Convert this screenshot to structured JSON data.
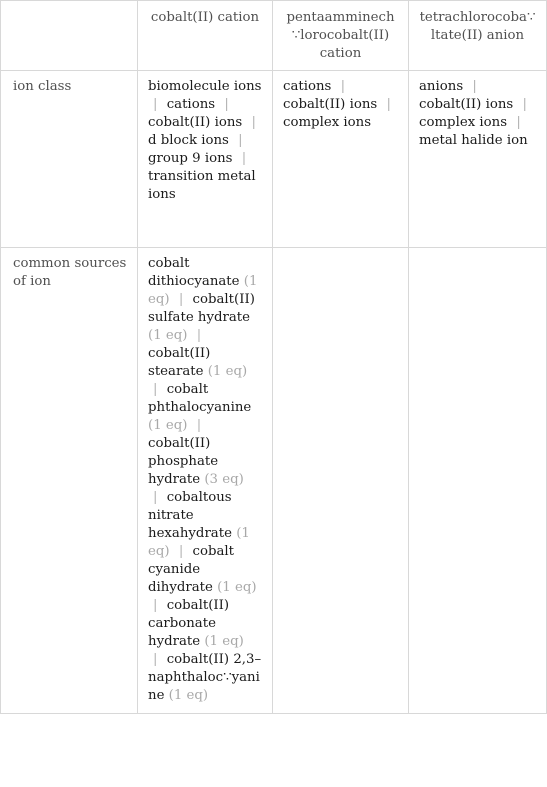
{
  "table": {
    "columns": [
      "",
      "cobalt(II) cation",
      "pentaamminechlorocobalt(II) cation",
      "tetrachlorocobaltate(II) anion"
    ],
    "column_display": [
      "",
      "cobalt(II) cation",
      "pentaamminech∵lorocobalt(II) cation",
      "tetrachlorocoba∵ltate(II) anion"
    ],
    "rows": [
      {
        "label": "ion class",
        "cells": [
          {
            "items": [
              {
                "text": "biomolecule ions"
              },
              {
                "text": "cations"
              },
              {
                "text": "cobalt(II) ions"
              },
              {
                "text": "d block ions"
              },
              {
                "text": "group 9 ions"
              },
              {
                "text": "transition metal ions"
              }
            ]
          },
          {
            "items": [
              {
                "text": "cations"
              },
              {
                "text": "cobalt(II) ions"
              },
              {
                "text": "complex ions"
              }
            ]
          },
          {
            "items": [
              {
                "text": "anions"
              },
              {
                "text": "cobalt(II) ions"
              },
              {
                "text": "complex ions"
              },
              {
                "text": "metal halide ion"
              }
            ]
          }
        ]
      },
      {
        "label": "common sources of ion",
        "cells": [
          {
            "items": [
              {
                "text": "cobalt dithiocyanate",
                "eq": "(1 eq)"
              },
              {
                "text": "cobalt(II) sulfate hydrate",
                "eq": "(1 eq)"
              },
              {
                "text": "cobalt(II) stearate",
                "eq": "(1 eq)"
              },
              {
                "text": "cobalt phthalocyanine",
                "eq": "(1 eq)"
              },
              {
                "text": "cobalt(II) phosphate hydrate",
                "eq": "(3 eq)"
              },
              {
                "text": "cobaltous nitrate hexahydrate",
                "eq": "(1 eq)"
              },
              {
                "text": "cobalt cyanide dihydrate",
                "eq": "(1 eq)"
              },
              {
                "text": "cobalt(II) carbonate hydrate",
                "eq": "(1 eq)"
              },
              {
                "text": "cobalt(II) 2,3–naphthaloc∵yanine",
                "eq": "(1 eq)"
              }
            ]
          },
          {
            "items": []
          },
          {
            "items": []
          }
        ]
      }
    ],
    "separator": "|"
  }
}
